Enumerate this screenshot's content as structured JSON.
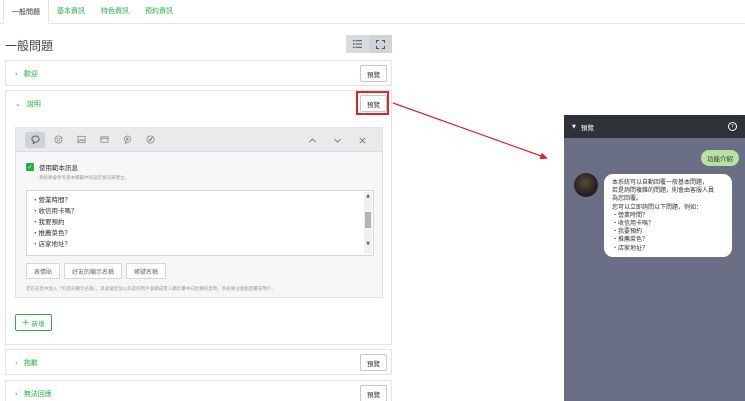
{
  "tabs": [
    {
      "label": "一般問題",
      "active": true
    },
    {
      "label": "基本資訊",
      "active": false
    },
    {
      "label": "特色資訊",
      "active": false
    },
    {
      "label": "預約資訊",
      "active": false
    }
  ],
  "page_title": "一般問題",
  "sections": {
    "welcome": {
      "label": "歡迎",
      "preview": "預覽"
    },
    "explain": {
      "label": "說明",
      "preview": "預覽"
    },
    "apology": {
      "label": "抱歉",
      "preview": "預覽"
    },
    "no_reply": {
      "label": "無法回應",
      "preview": "預覽"
    }
  },
  "editor": {
    "use_template_label": "使用範本訊息",
    "use_template_hint": "系統將會參考基本欄裏中的設定資訊來建立。",
    "lines": [
      "・營業時間？",
      "・收信用卡嗎？",
      "・我要預約",
      "・推薦菜色？",
      "・店家地址？"
    ],
    "tags": [
      "表情貼",
      "好友的顯示名稱",
      "帳號名稱"
    ],
    "tag_hint": "若在訊息中加入「好友的顯示名稱」，其會當您加入好友的用戶會顯成客人顯示畫中向您傳訊息時，系統將注意動回覆該用戶。"
  },
  "add_button": {
    "plus": "+",
    "label": "新增"
  },
  "preview_panel": {
    "title": "預覽",
    "help_icon": "?",
    "user_message": "功能介紹",
    "bot_lines": [
      "本系統可以自動回覆一般基本問題，",
      "若是詢問複雜的問題，則會由客服人員",
      "為您回覆。",
      "您可以立即詢問以下問題，例如：",
      "・營業時間？",
      "・收信用卡嗎？",
      "・我要預約",
      "・推薦菜色？",
      "・店家地址？"
    ]
  },
  "colors": {
    "accent": "#27b045",
    "highlight": "#e02525",
    "panel_bg": "#6a6f85"
  }
}
